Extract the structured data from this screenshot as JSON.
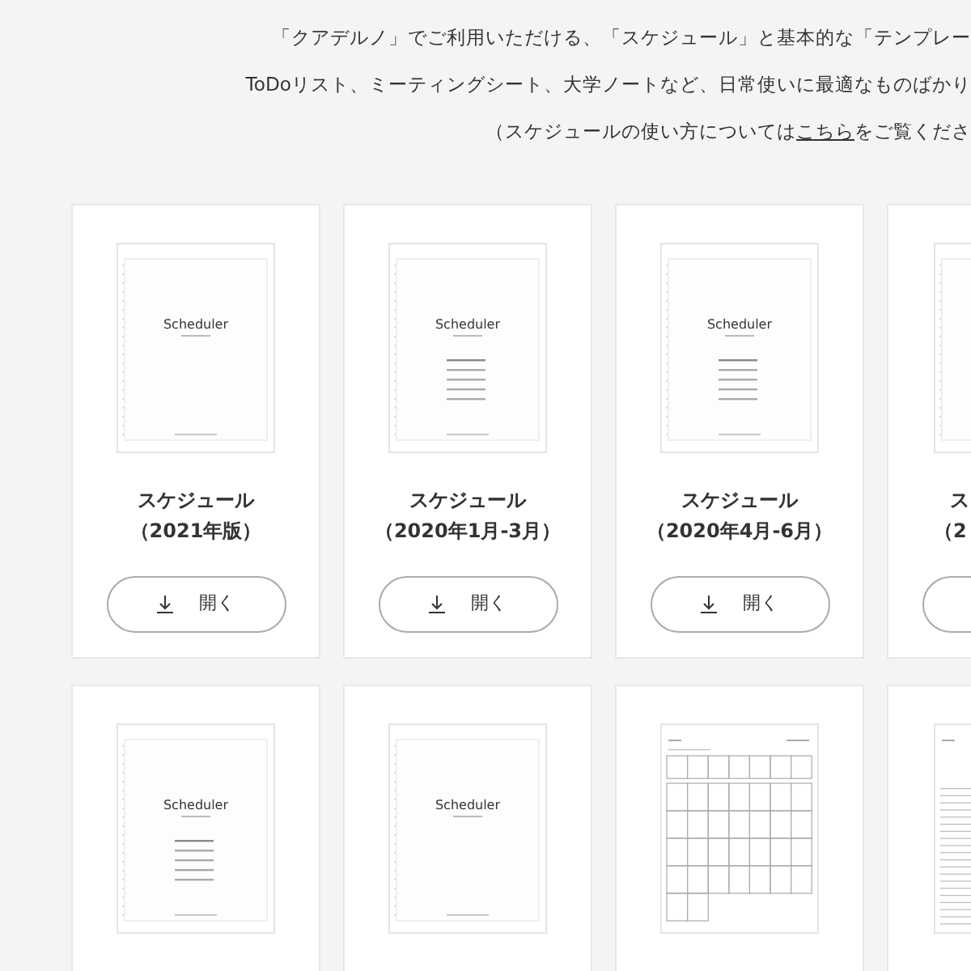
{
  "intro": [
    {
      "parts": [
        {
          "text": "「クアデルノ」でご利用いただける、「スケジュール」と基本的な「テンプレー"
        }
      ]
    },
    {
      "parts": [
        {
          "text": "ToDoリスト、ミーティングシート、大学ノートなど、日常使いに最適なものばかり"
        }
      ]
    },
    {
      "parts": [
        {
          "text": "（スケジュールの使い方については"
        },
        {
          "text": "こちら",
          "link": true
        },
        {
          "text": "をご覧くださ"
        }
      ]
    }
  ],
  "rows": [
    [
      {
        "thumbnail": {
          "kind": "scheduler",
          "title": "Scheduler"
        },
        "title": "スケジュール",
        "subtitle": "（2021年版）",
        "open_button": true,
        "button_label": "開く"
      },
      {
        "thumbnail": {
          "kind": "scheduler-list",
          "title": "Scheduler"
        },
        "title": "スケジュール",
        "subtitle": "（2020年1月-3月）",
        "open_button": true,
        "button_label": "開く"
      },
      {
        "thumbnail": {
          "kind": "scheduler-list",
          "title": "Scheduler"
        },
        "title": "スケジュール",
        "subtitle": "（2020年4月-6月）",
        "open_button": true,
        "button_label": "開く"
      },
      {
        "kind": "cut",
        "thumbnail": {
          "kind": "scheduler"
        },
        "title": "ス",
        "subtitle": "（2",
        "open_button": true
      }
    ],
    [
      {
        "thumbnail": {
          "kind": "scheduler-list",
          "title": "Scheduler"
        }
      },
      {
        "thumbnail": {
          "kind": "scheduler",
          "title": "Scheduler"
        }
      },
      {
        "thumbnail": {
          "kind": "calendar"
        }
      },
      {
        "kind": "cut",
        "thumbnail": {
          "kind": "list"
        }
      }
    ]
  ]
}
